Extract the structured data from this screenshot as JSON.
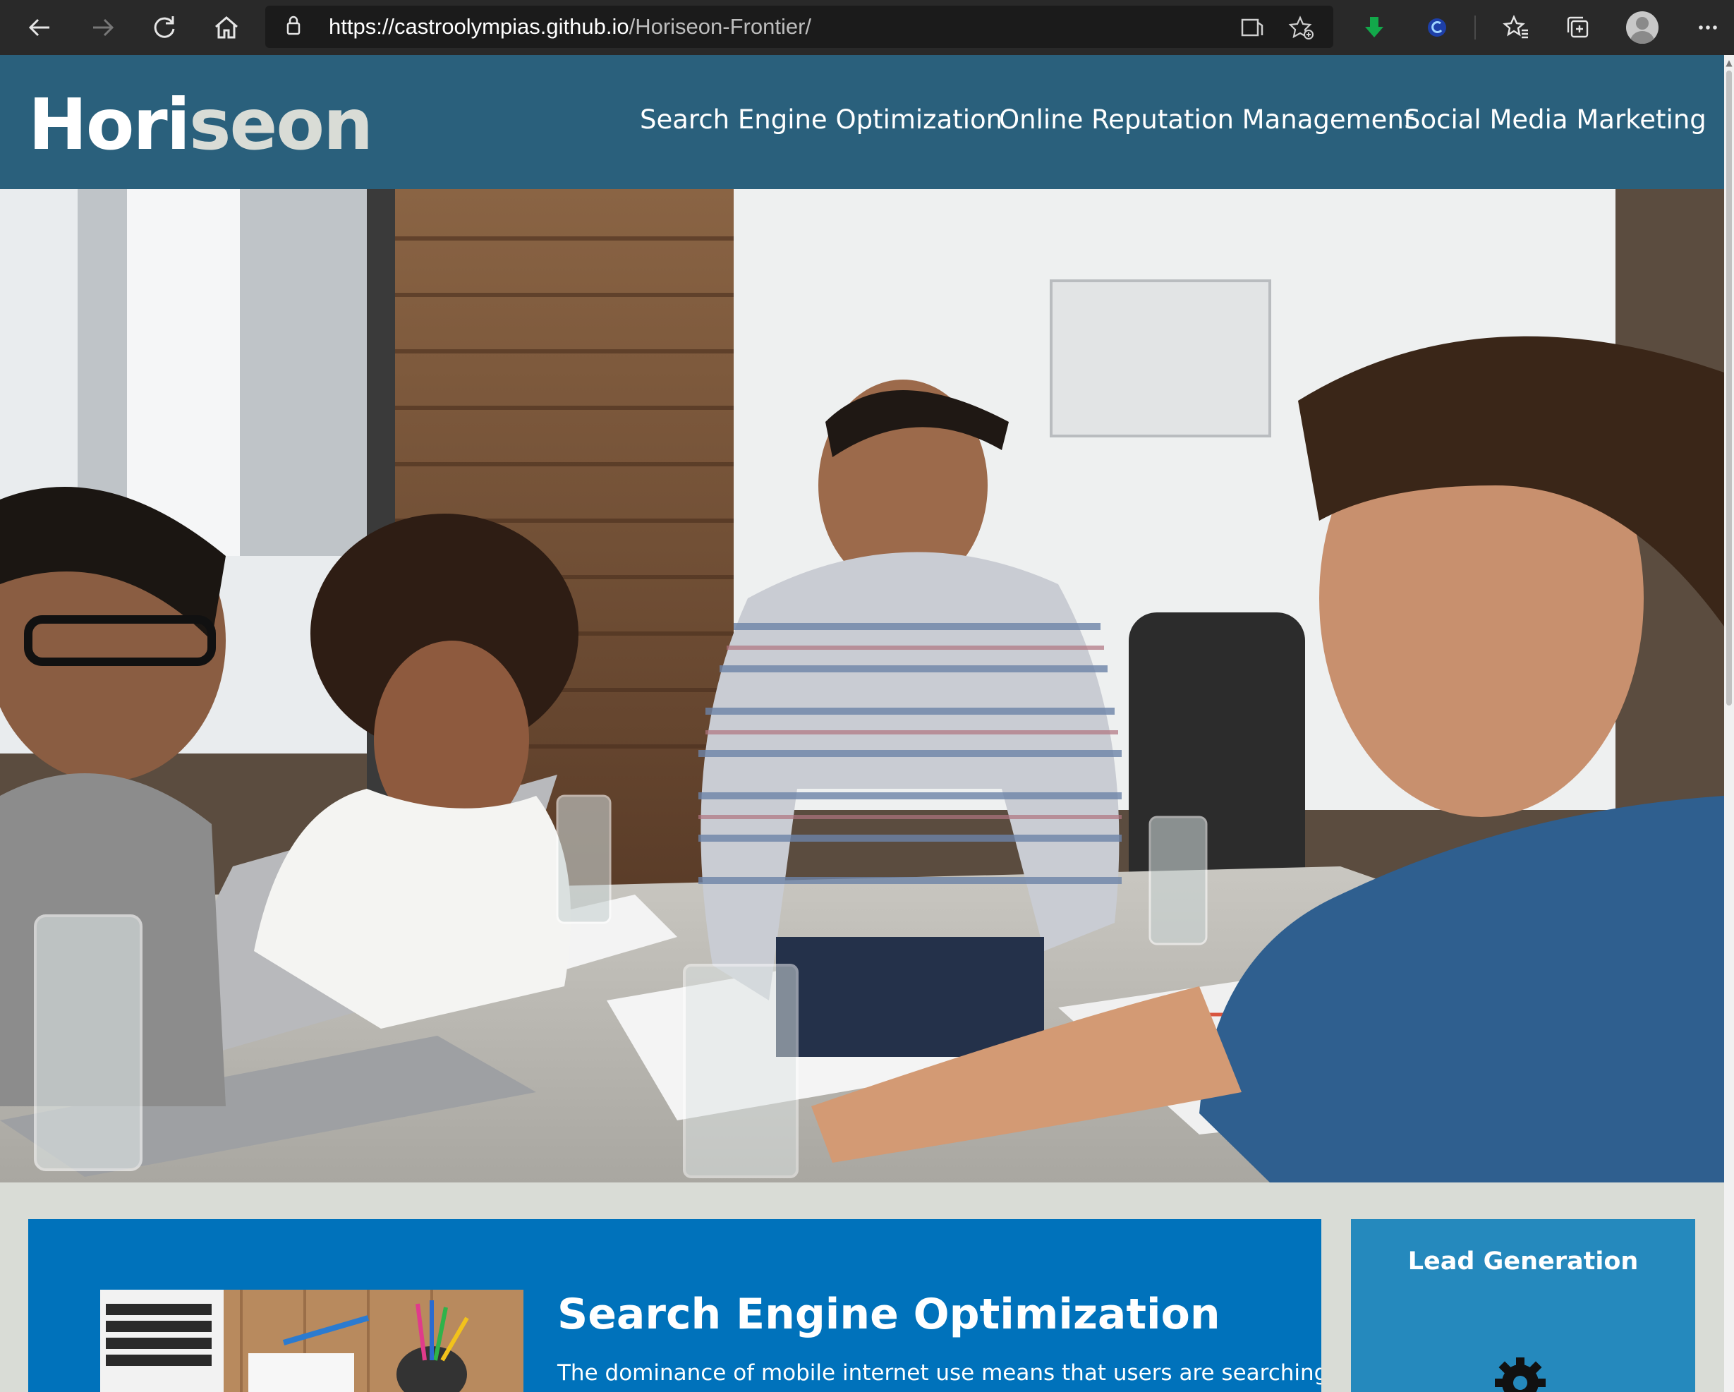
{
  "browser": {
    "url_host": "https://castroolympias.github.io",
    "url_path": "/Horiseon-Frontier/",
    "icons": [
      "back-icon",
      "forward-icon",
      "refresh-icon",
      "home-icon",
      "lock-icon",
      "reader-view-icon",
      "add-favorite-icon",
      "download-extension-icon",
      "edge-extension-icon",
      "favorites-icon",
      "collections-icon",
      "profile-avatar",
      "more-icon"
    ]
  },
  "header": {
    "logo_primary": "Hori",
    "logo_secondary": "seon",
    "nav": [
      {
        "label": "Search Engine Optimization"
      },
      {
        "label": "Online Reputation Management"
      },
      {
        "label": "Social Media Marketing"
      }
    ]
  },
  "content": {
    "section_title": "Search Engine Optimization",
    "section_text": "The dominance of mobile internet use means that users are searching for"
  },
  "benefits": {
    "title": "Lead Generation"
  },
  "colors": {
    "header_bg": "#2a607c",
    "content_bg": "#0072bb",
    "benefit_bg": "#2589bd",
    "page_bg": "#d9dcd6"
  }
}
